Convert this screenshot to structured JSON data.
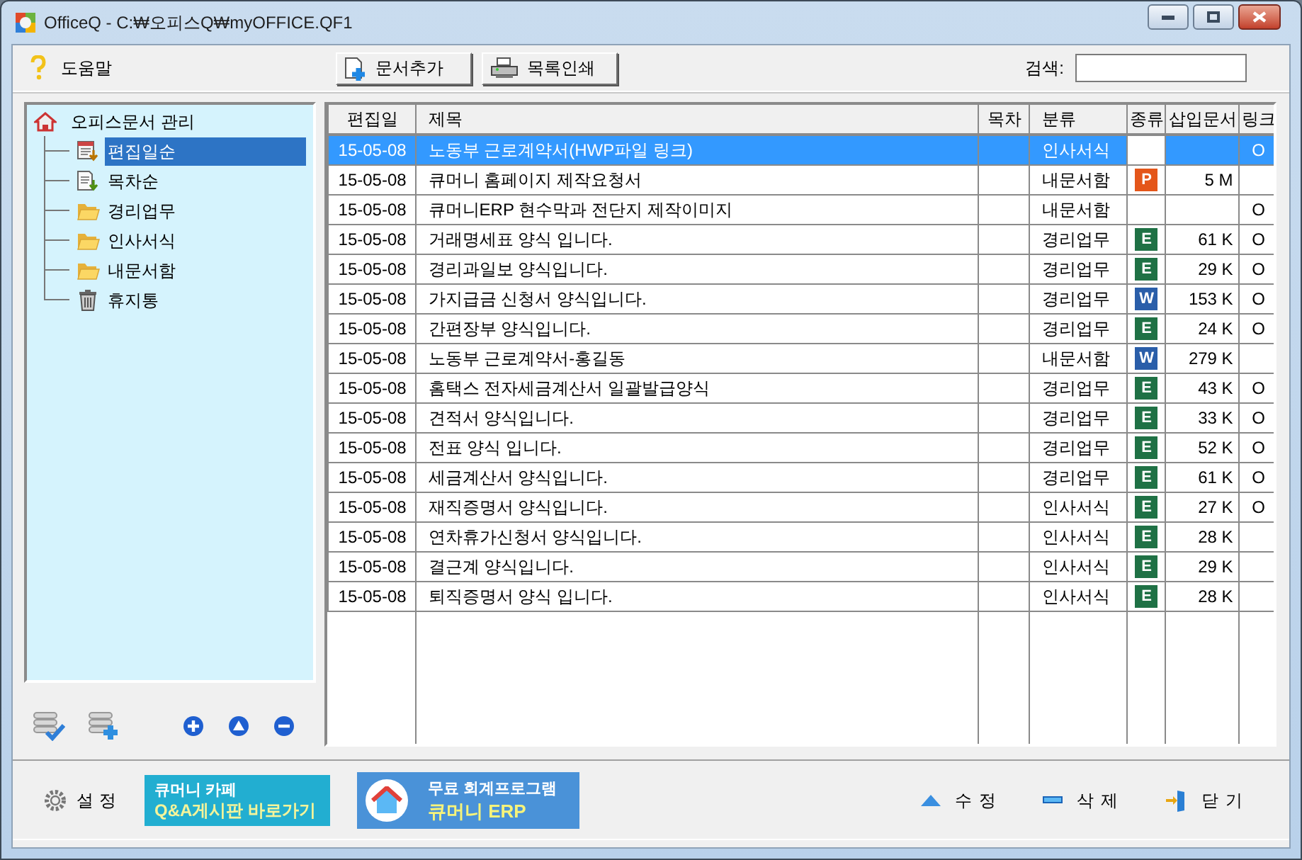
{
  "window": {
    "title": "OfficeQ - C:₩오피스Q₩myOFFICE.QF1"
  },
  "toolbar": {
    "help": "도움말",
    "buttons": [
      {
        "label": "문서추가",
        "kind": "add"
      },
      {
        "label": "목록인쇄",
        "kind": "print"
      }
    ],
    "search": {
      "label": "검색:"
    }
  },
  "tree": {
    "label": "오피스문서 관리",
    "children": [
      {
        "label": "편집일순",
        "kind": "date",
        "selected": true
      },
      {
        "label": "목차순",
        "kind": "order",
        "selected": false
      },
      {
        "label": "경리업무",
        "kind": "folder",
        "selected": false
      },
      {
        "label": "인사서식",
        "kind": "folder",
        "selected": false
      },
      {
        "label": "내문서함",
        "kind": "folder",
        "selected": false
      },
      {
        "label": "휴지통",
        "kind": "trash",
        "selected": false
      }
    ]
  },
  "table": {
    "columns": [
      "편집일",
      "제목",
      "목차",
      "분류",
      "종류",
      "삽입문서",
      "링크"
    ],
    "rows": [
      {
        "date": "15-05-08",
        "title": "노동부 근로계약서(HWP파일 링크)",
        "category": "인사서식",
        "link": "O",
        "selected": true
      },
      {
        "date": "15-05-08",
        "title": "큐머니 홈페이지 제작요청서",
        "category": "내문서함",
        "file": {
          "kind": "ppt",
          "badge": "P"
        },
        "size": "5 M",
        "selected": false
      },
      {
        "date": "15-05-08",
        "title": "큐머니ERP 현수막과 전단지 제작이미지",
        "category": "내문서함",
        "link": "O",
        "selected": false
      },
      {
        "date": "15-05-08",
        "title": "거래명세표 양식 입니다.",
        "category": "경리업무",
        "file": {
          "kind": "excel",
          "badge": "E"
        },
        "size": "61 K",
        "link": "O",
        "selected": false
      },
      {
        "date": "15-05-08",
        "title": "경리과일보 양식입니다.",
        "category": "경리업무",
        "file": {
          "kind": "excel",
          "badge": "E"
        },
        "size": "29 K",
        "link": "O",
        "selected": false
      },
      {
        "date": "15-05-08",
        "title": "가지급금 신청서 양식입니다.",
        "category": "경리업무",
        "file": {
          "kind": "word",
          "badge": "W"
        },
        "size": "153 K",
        "link": "O",
        "selected": false
      },
      {
        "date": "15-05-08",
        "title": "간편장부 양식입니다.",
        "category": "경리업무",
        "file": {
          "kind": "excel",
          "badge": "E"
        },
        "size": "24 K",
        "link": "O",
        "selected": false
      },
      {
        "date": "15-05-08",
        "title": "노동부 근로계약서-홍길동",
        "category": "내문서함",
        "file": {
          "kind": "word",
          "badge": "W"
        },
        "size": "279 K",
        "selected": false
      },
      {
        "date": "15-05-08",
        "title": "홈택스 전자세금계산서 일괄발급양식",
        "category": "경리업무",
        "file": {
          "kind": "excel",
          "badge": "E"
        },
        "size": "43 K",
        "link": "O",
        "selected": false
      },
      {
        "date": "15-05-08",
        "title": "견적서 양식입니다.",
        "category": "경리업무",
        "file": {
          "kind": "excel",
          "badge": "E"
        },
        "size": "33 K",
        "link": "O",
        "selected": false
      },
      {
        "date": "15-05-08",
        "title": "전표 양식 입니다.",
        "category": "경리업무",
        "file": {
          "kind": "excel",
          "badge": "E"
        },
        "size": "52 K",
        "link": "O",
        "selected": false
      },
      {
        "date": "15-05-08",
        "title": "세금계산서 양식입니다.",
        "category": "경리업무",
        "file": {
          "kind": "excel",
          "badge": "E"
        },
        "size": "61 K",
        "link": "O",
        "selected": false
      },
      {
        "date": "15-05-08",
        "title": "재직증명서 양식입니다.",
        "category": "인사서식",
        "file": {
          "kind": "excel",
          "badge": "E"
        },
        "size": "27 K",
        "link": "O",
        "selected": false
      },
      {
        "date": "15-05-08",
        "title": "연차휴가신청서 양식입니다.",
        "category": "인사서식",
        "file": {
          "kind": "excel",
          "badge": "E"
        },
        "size": "28 K",
        "selected": false
      },
      {
        "date": "15-05-08",
        "title": "결근계 양식입니다.",
        "category": "인사서식",
        "file": {
          "kind": "excel",
          "badge": "E"
        },
        "size": "29 K",
        "selected": false
      },
      {
        "date": "15-05-08",
        "title": "퇴직증명서 양식 입니다.",
        "category": "인사서식",
        "file": {
          "kind": "excel",
          "badge": "E"
        },
        "size": "28 K",
        "selected": false
      }
    ]
  },
  "footer": {
    "settings": "설정",
    "banners": [
      {
        "lines": [
          "큐머니 카페",
          "Q&A게시판 바로가기"
        ],
        "kind": "cafe"
      },
      {
        "lines": [
          "무료 회계프로그램",
          "큐머니 ERP"
        ],
        "kind": "erp"
      }
    ],
    "actions": [
      {
        "label": "수정",
        "kind": "edit"
      },
      {
        "label": "삭제",
        "kind": "delete"
      },
      {
        "label": "닫기",
        "kind": "close"
      }
    ]
  }
}
